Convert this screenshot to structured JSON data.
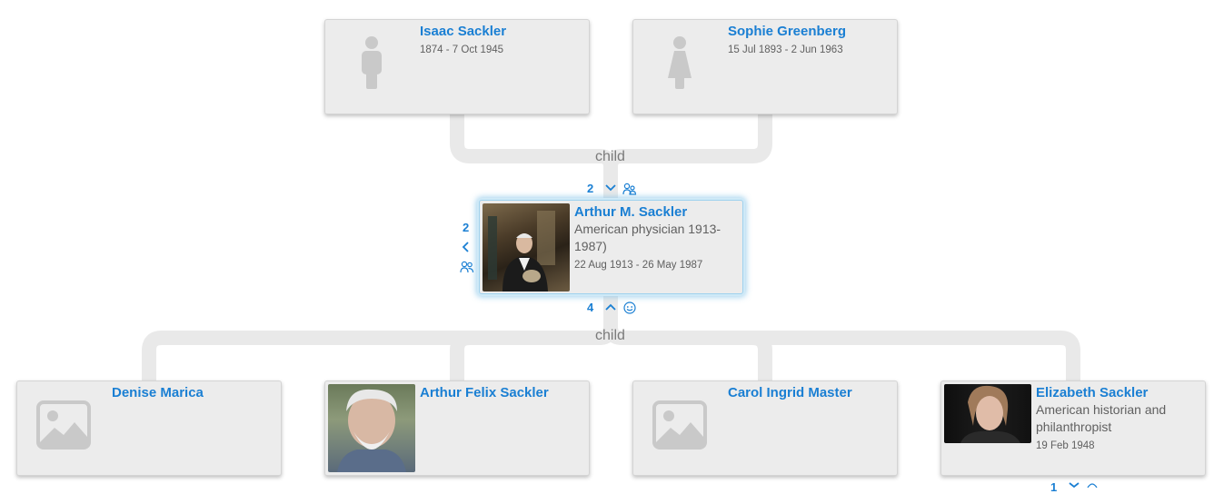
{
  "parents": {
    "label": "child",
    "father": {
      "name": "Isaac Sackler",
      "dates": "1874 - 7 Oct 1945",
      "icon": "male-silhouette-icon"
    },
    "mother": {
      "name": "Sophie Greenberg",
      "dates": "15 Jul 1893 - 2 Jun 1963",
      "icon": "female-silhouette-icon"
    }
  },
  "focus": {
    "name": "Arthur M. Sackler",
    "description": "American physician 1913-1987)",
    "dates": "22 Aug 1913 - 26 May 1987",
    "parents_count": "2",
    "spouses_count": "2",
    "children_count": "4"
  },
  "children": {
    "label": "child",
    "items": [
      {
        "name": "Denise Marica",
        "description": "",
        "dates": ""
      },
      {
        "name": "Arthur Felix Sackler",
        "description": "",
        "dates": ""
      },
      {
        "name": "Carol Ingrid Master",
        "description": "",
        "dates": ""
      },
      {
        "name": "Elizabeth Sackler",
        "description": "American historian and philanthropist",
        "dates": "19 Feb 1948"
      }
    ],
    "last_child_count": "1"
  },
  "colors": {
    "link": "#1a7fd3",
    "card_bg": "#ececec",
    "connector": "#e9e9e9"
  }
}
